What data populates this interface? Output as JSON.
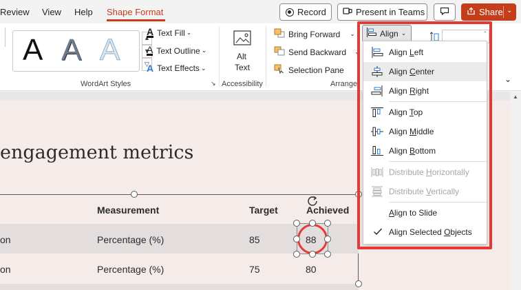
{
  "tabs": {
    "review": "Review",
    "view": "View",
    "help": "Help",
    "shape_format": "Shape Format"
  },
  "top_buttons": {
    "record": "Record",
    "present_in_teams": "Present in Teams",
    "share": "Share"
  },
  "ribbon": {
    "text_fill": "Text Fill",
    "text_outline": "Text Outline",
    "text_effects": "Text Effects",
    "wordart_letter": "A",
    "wordart_group": "WordArt Styles",
    "alt_text_line1": "Alt",
    "alt_text_line2": "Text",
    "accessibility_group": "Accessibility",
    "bring_forward": "Bring Forward",
    "send_backward": "Send Backward",
    "selection_pane": "Selection Pane",
    "arrange_group": "Arrange",
    "align": "Align"
  },
  "slide": {
    "title": "engagement metrics",
    "table": {
      "headers": [
        "Measurement",
        "Target",
        "Achieved"
      ],
      "rows": [
        {
          "first": "on",
          "measurement": "Percentage (%)",
          "target": "85",
          "achieved": "88"
        },
        {
          "first": "on",
          "measurement": "Percentage (%)",
          "target": "75",
          "achieved": "80"
        }
      ]
    }
  },
  "align_menu": {
    "items": [
      {
        "pre": "Align ",
        "key": "L",
        "post": "eft",
        "icon": "align-left-icon"
      },
      {
        "pre": "Align ",
        "key": "C",
        "post": "enter",
        "icon": "align-center-icon"
      },
      {
        "pre": "Align ",
        "key": "R",
        "post": "ight",
        "icon": "align-right-icon"
      },
      {
        "pre": "Align ",
        "key": "T",
        "post": "op",
        "icon": "align-top-icon"
      },
      {
        "pre": "Align ",
        "key": "M",
        "post": "iddle",
        "icon": "align-middle-icon"
      },
      {
        "pre": "Align ",
        "key": "B",
        "post": "ottom",
        "icon": "align-bottom-icon"
      },
      {
        "pre": "Distribute ",
        "key": "H",
        "post": "orizontally",
        "icon": "distribute-horizontally-icon"
      },
      {
        "pre": "Distribute ",
        "key": "V",
        "post": "ertically",
        "icon": "distribute-vertically-icon"
      },
      {
        "pre": "",
        "key": "A",
        "post": "lign to Slide",
        "icon": ""
      },
      {
        "pre": "Align Selected ",
        "key": "O",
        "post": "bjects",
        "icon": "checkmark-icon"
      }
    ]
  },
  "colors": {
    "accent": "#c43e1c",
    "highlight_border": "#e53935",
    "slide_bg": "#f5ebe9"
  }
}
